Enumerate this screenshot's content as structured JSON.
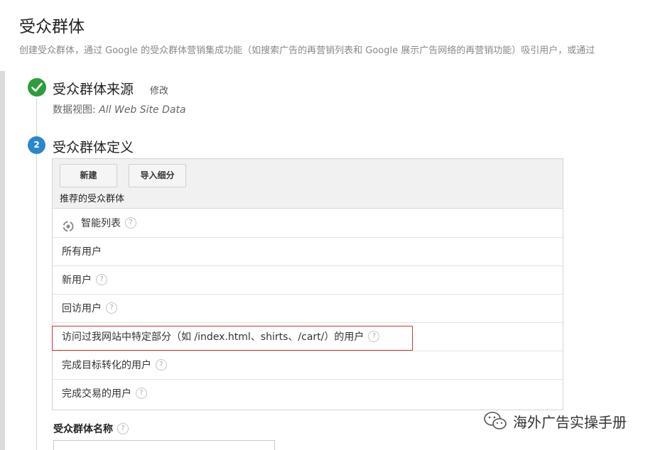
{
  "page": {
    "title": "受众群体",
    "description": "创建受众群体，通过 Google 的受众群体营销集成功能（如搜索广告的再营销列表和 Google 展示广告网络的再营销功能）吸引用户，或通过"
  },
  "step1": {
    "title": "受众群体来源",
    "edit_label": "修改",
    "dataview_label": "数据视图: ",
    "dataview_value": "All Web Site Data"
  },
  "step2": {
    "number": "2",
    "title": "受众群体定义",
    "buttons": {
      "new_label": "新建",
      "import_label": "导入细分"
    },
    "section_header": "推荐的受众群体",
    "help_glyph": "?",
    "items": [
      {
        "label": "智能列表",
        "icon": "smart-list-icon",
        "help": true
      },
      {
        "label": "所有用户",
        "help": false
      },
      {
        "label": "新用户",
        "help": true
      },
      {
        "label": "回访用户",
        "help": true
      },
      {
        "label": "访问过我网站中特定部分（如 /index.html、shirts、/cart/）的用户",
        "help": true,
        "highlighted": true
      },
      {
        "label": "完成目标转化的用户",
        "help": true
      },
      {
        "label": "完成交易的用户",
        "help": true
      }
    ],
    "name_label": "受众群体名称"
  },
  "colors": {
    "step_done": "#2d9d3b",
    "step_active": "#2b87c8",
    "highlight_border": "#d03434"
  },
  "watermark": {
    "text": "海外广告实操手册",
    "icon": "wechat-icon"
  }
}
